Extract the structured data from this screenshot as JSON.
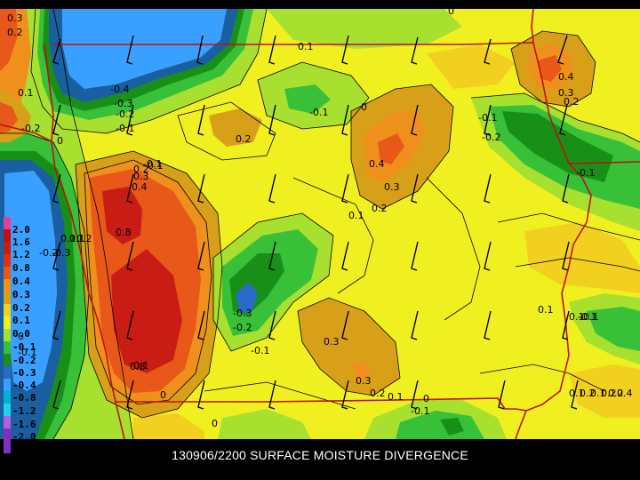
{
  "map": {
    "title": "130906/2200 SURFACE MOISTURE DIVERGENCE",
    "legend": [
      "2.0",
      "1.6",
      "1.2",
      "0.8",
      "0.4",
      "0.3",
      "0.2",
      "0.1",
      "0.0",
      "-0.1",
      "-0.2",
      "-0.3",
      "-0.4",
      "-0.8",
      "-1.2",
      "-1.6",
      "-2.0"
    ],
    "legend_colors": [
      "#e0409a",
      "#c01010",
      "#c81c14",
      "#e03010",
      "#e85818",
      "#f0901c",
      "#d8a018",
      "#f2d020",
      "#f0f020",
      "#a8e030",
      "#38c038",
      "#189018",
      "#2a6ac8",
      "#3aa0ff",
      "#00b0d0",
      "#20d0f0",
      "#b060e0",
      "#8030c0"
    ],
    "contour_labels": [
      "0.3",
      "0.2",
      "0.1",
      "-0.4",
      "-0.3",
      "-0.2",
      "-0.1",
      "-0.2",
      "0",
      "0.1",
      "0",
      "0.2",
      "-0.1",
      "0",
      "-0.1",
      "0.4",
      "0.3",
      "0.2",
      "0",
      "-0.1",
      "-0.2",
      "0.4",
      "0.3",
      "0.2",
      "0.1",
      "0.2",
      "-0.1",
      "0.1",
      "0.4",
      "0.3",
      "0.2",
      "0.1",
      "-0.1",
      "0.8",
      "0.1",
      "-0.2",
      "0.2",
      "-0.3",
      "0.2",
      "-0.2",
      "-0.1",
      "0.3",
      "0.3",
      "0.2",
      "-0.1",
      "0.1",
      "0",
      "0.1",
      "0.1",
      "0",
      "0.8",
      "-0.1",
      "0.1",
      "-0.1",
      "0",
      "0.1",
      "0.2",
      "0.4",
      "0.1",
      "-0.3"
    ]
  }
}
